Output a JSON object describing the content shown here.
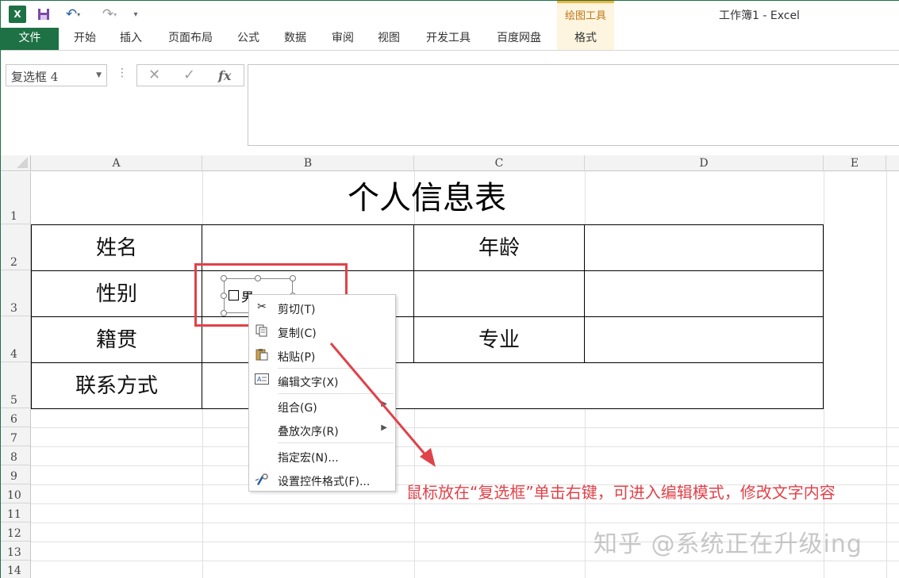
{
  "window": {
    "title": "工作簿1 - Excel",
    "app_icon": "excel-logo-icon",
    "qat": [
      "save-icon",
      "undo-icon",
      "redo-icon",
      "customize-qat-icon"
    ],
    "contextual_tools_label": "绘图工具"
  },
  "ribbon": {
    "tabs": [
      "文件",
      "开始",
      "插入",
      "页面布局",
      "公式",
      "数据",
      "审阅",
      "视图",
      "开发工具",
      "百度网盘",
      "格式"
    ]
  },
  "formula_bar": {
    "name_box": "复选框 4",
    "cancel_icon": "cancel-x-icon",
    "enter_icon": "enter-check-icon",
    "fx_label": "fx",
    "content": ""
  },
  "columns": [
    "A",
    "B",
    "C",
    "D",
    "E"
  ],
  "rows": [
    "1",
    "2",
    "3",
    "4",
    "5",
    "6",
    "7",
    "8",
    "9",
    "10",
    "11",
    "12",
    "13",
    "14"
  ],
  "table": {
    "title": "个人信息表",
    "labels": {
      "name": "姓名",
      "age": "年龄",
      "gender": "性别",
      "origin": "籍贯",
      "major": "专业",
      "contact": "联系方式"
    }
  },
  "checkbox": {
    "label": "男",
    "checked": false
  },
  "context_menu": {
    "items": [
      {
        "label": "剪切(T)",
        "icon": "scissors-icon"
      },
      {
        "label": "复制(C)",
        "icon": "copy-icon"
      },
      {
        "label": "粘贴(P)",
        "icon": "paste-icon"
      },
      {
        "label": "编辑文字(X)",
        "icon": "edit-text-icon"
      },
      {
        "label": "组合(G)",
        "icon": "",
        "submenu": true
      },
      {
        "label": "叠放次序(R)",
        "icon": "",
        "submenu": true
      },
      {
        "label": "指定宏(N)...",
        "icon": ""
      },
      {
        "label": "设置控件格式(F)...",
        "icon": "format-control-icon"
      }
    ]
  },
  "annotation": {
    "text": "鼠标放在“复选框”单击右键，可进入编辑模式，修改文字内容",
    "color": "#e0424a"
  },
  "watermark": "知乎 @系统正在升级ing",
  "colors": {
    "excel_green": "#1e7145",
    "highlight_red": "#e0424a",
    "tools_orange": "#f0b540"
  }
}
